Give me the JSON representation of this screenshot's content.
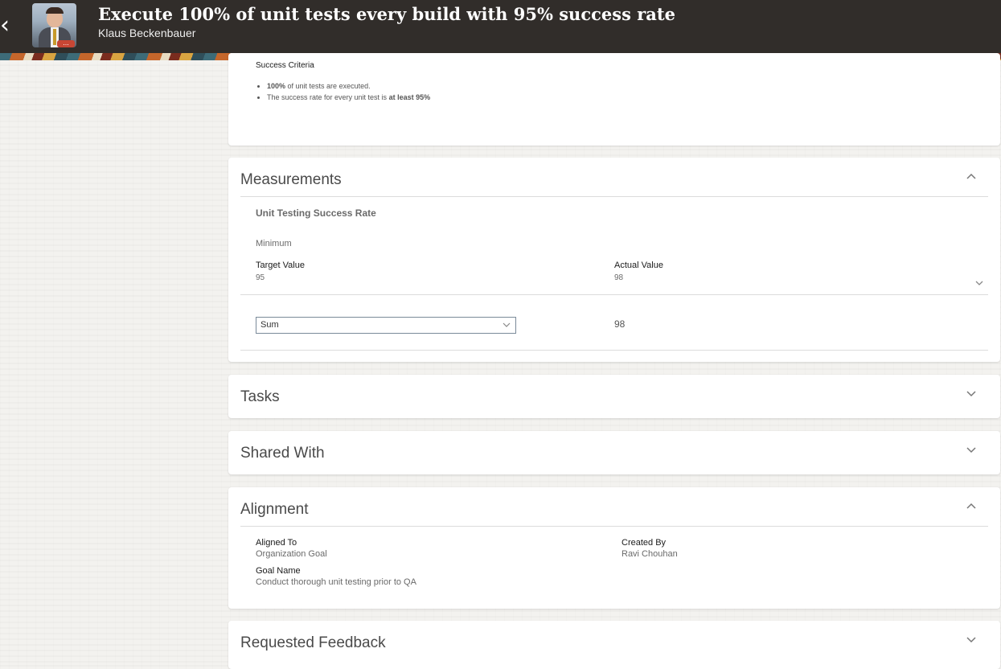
{
  "header": {
    "title": "Execute 100% of unit tests every build with 95% success rate",
    "employee_name": "Klaus Beckenbauer",
    "more_indicator": "..."
  },
  "success_criteria": {
    "heading": "Success Criteria",
    "items": [
      {
        "bold": "100%",
        "text": " of unit tests are executed."
      },
      {
        "text": "The success rate for every unit test is ",
        "bold": "at least 95%"
      }
    ]
  },
  "measurements": {
    "title": "Measurements",
    "name": "Unit Testing Success Rate",
    "type": "Minimum",
    "target_label": "Target Value",
    "target_value": "95",
    "actual_label": "Actual Value",
    "actual_value": "98",
    "aggregation_selected": "Sum",
    "aggregation_result": "98"
  },
  "tasks": {
    "title": "Tasks"
  },
  "shared_with": {
    "title": "Shared With"
  },
  "alignment": {
    "title": "Alignment",
    "aligned_to_label": "Aligned To",
    "aligned_to_value": "Organization Goal",
    "created_by_label": "Created By",
    "created_by_value": "Ravi Chouhan",
    "goal_name_label": "Goal Name",
    "goal_name_value": "Conduct thorough unit testing prior to QA"
  },
  "requested_feedback": {
    "title": "Requested Feedback"
  },
  "colors": {
    "header_bg": "#312d2a",
    "card_bg": "#ffffff",
    "page_bg": "#f3f2ef"
  }
}
